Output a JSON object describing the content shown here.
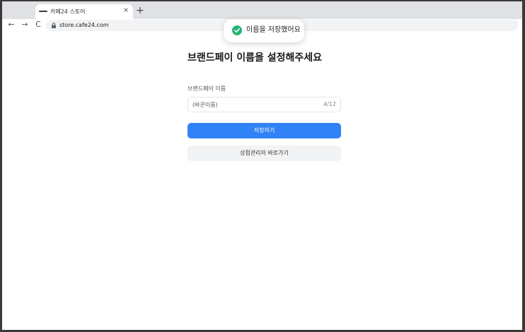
{
  "browser": {
    "tab_title": "카페24 스토어",
    "tab_close": "×",
    "new_tab": "+",
    "url": "store.cafe24.com",
    "back": "←",
    "forward": "→",
    "reload": "C"
  },
  "toast": {
    "message": "이름을 저장했어요",
    "icon": "check-circle-icon",
    "color": "#22b573"
  },
  "page": {
    "title": "브랜드페이 이름을 설정해주세요",
    "field_label": "브랜드페이 이름",
    "input_value": "(바꾼이름)",
    "char_count": "4/12",
    "save_label": "저장하기",
    "admin_label": "상점관리자 바로가기"
  },
  "colors": {
    "primary": "#3182f6",
    "secondary_bg": "#f2f3f5",
    "outer_frame": "#3a3a3a"
  }
}
